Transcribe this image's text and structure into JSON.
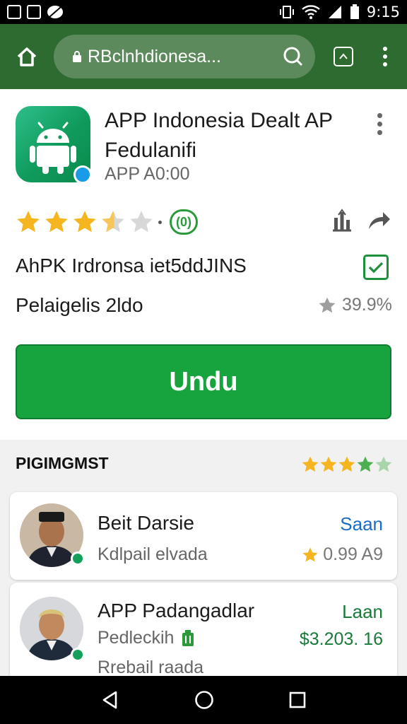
{
  "status_bar": {
    "time": "9:15"
  },
  "browser": {
    "url": "RBclnhdionesa..."
  },
  "app": {
    "title": "APP Indonesia Dealt AP Fedulanifi",
    "subtitle": "APP A0:00"
  },
  "rating": {
    "badge": "(0)"
  },
  "info": {
    "line1": "AhPK Irdronsa iet5ddJINS",
    "line2": "Pelaigelis 2ldo",
    "percent": "39.9%"
  },
  "download_label": "Undu",
  "reviews": {
    "heading": "PIGIMGMST",
    "items": [
      {
        "name": "Beit Darsie",
        "sub": "Kdlpail elvada",
        "tag": "Saan",
        "rate": "0.99 A9"
      },
      {
        "name": "APP Padangadlar",
        "sub": "Pedleckih",
        "sub2": "Rrebail raada",
        "tag": "Laan",
        "rate": "$3.203. 16"
      }
    ]
  },
  "colors": {
    "toolbar": "#2e6b31",
    "accent": "#17a33e",
    "star": "#f5b521"
  }
}
